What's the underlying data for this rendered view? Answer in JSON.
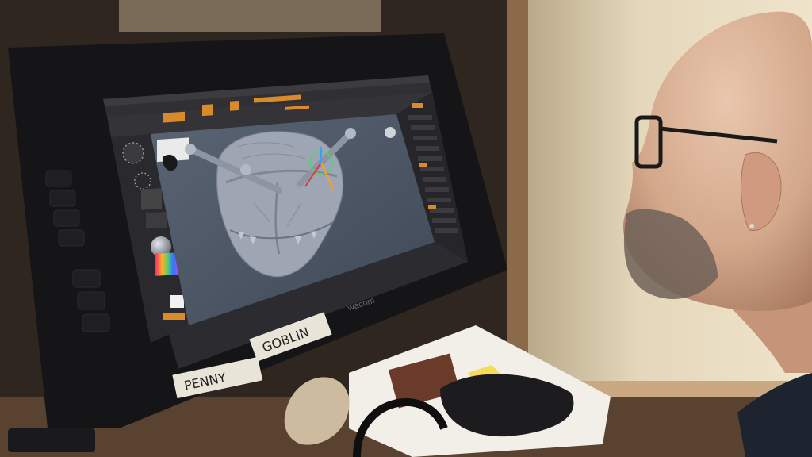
{
  "tablet": {
    "brand": "wacom"
  },
  "tape_labels": {
    "left": "PENNY",
    "right": "GOBLIN"
  },
  "colors": {
    "ui_orange": "#d98a2a",
    "viewport_bg": "#4d5766",
    "ui_dark": "#2a2a2e",
    "model_gray": "#9ea5b3",
    "wall": "#e8dcc3"
  }
}
